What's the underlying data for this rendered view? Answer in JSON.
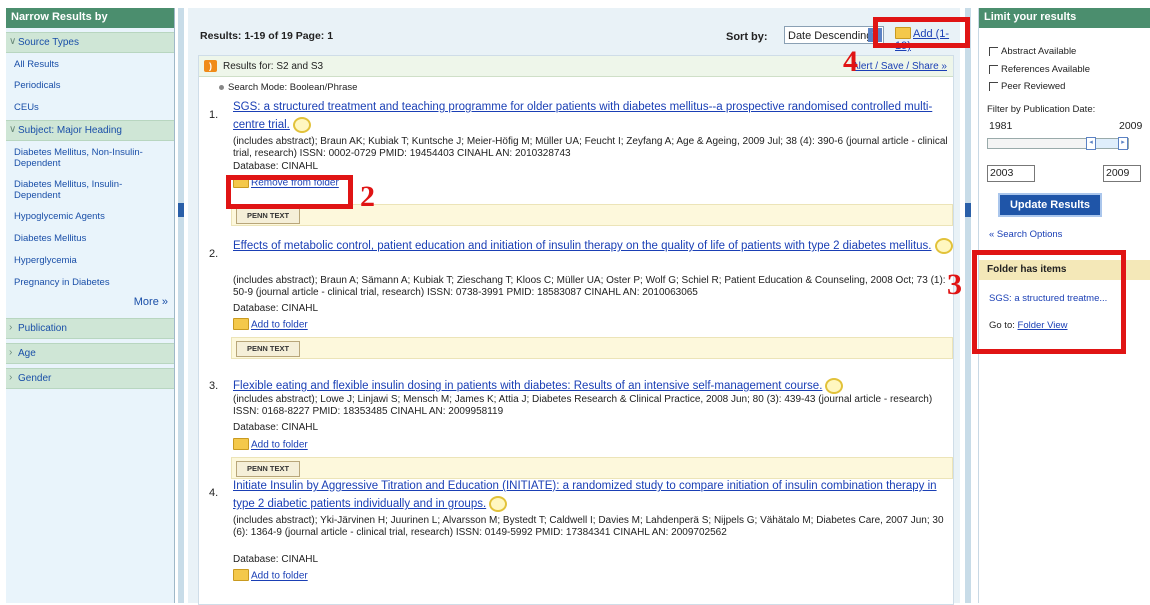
{
  "left_sidebar": {
    "header": "Narrow Results by",
    "source_types_label": "Source Types",
    "source_types": [
      "All Results",
      "Periodicals",
      "CEUs"
    ],
    "subject_label": "Subject: Major Heading",
    "subjects": [
      "Diabetes Mellitus, Non-Insulin-Dependent",
      "Diabetes Mellitus, Insulin-Dependent",
      "Hypoglycemic Agents",
      "Diabetes Mellitus",
      "Hyperglycemia",
      "Pregnancy in Diabetes"
    ],
    "more": "More »",
    "groups": [
      "Publication",
      "Age",
      "Gender"
    ]
  },
  "results_bar": {
    "label": "Results: 1-19 of 19   Page: 1",
    "sort_label": "Sort by:",
    "sort_value": "Date Descending",
    "add_all": "Add (1-19)"
  },
  "results_for": {
    "label": "Results for:  S2 and S3",
    "alert": "Alert / Save / Share »",
    "mode": "Search Mode: Boolean/Phrase"
  },
  "records": [
    {
      "num": "1.",
      "title": "SGS: a structured treatment and teaching programme for older patients with diabetes mellitus--a prospective randomised controlled multi-centre trial.",
      "details": "(includes abstract); Braun AK; Kubiak T; Kuntsche J; Meier-Höfig M; Müller UA; Feucht I; Zeyfang A; Age & Ageing, 2009 Jul; 38 (4): 390-6 (journal article - clinical trial, research) ISSN: 0002-0729 PMID: 19454403 CINAHL AN: 2010328743",
      "database": "Database: CINAHL",
      "folder_action": "Remove from folder"
    },
    {
      "num": "2.",
      "title": "Effects of metabolic control, patient education and initiation of insulin therapy on the quality of life of patients with type 2 diabetes mellitus.",
      "details": "(includes abstract); Braun A; Sämann A; Kubiak T; Zieschang T; Kloos C; Müller UA; Oster P; Wolf G; Schiel R; Patient Education & Counseling, 2008 Oct; 73 (1): 50-9 (journal article - clinical trial, research) ISSN: 0738-3991 PMID: 18583087 CINAHL AN: 2010063065",
      "database": "Database: CINAHL",
      "folder_action": "Add to folder"
    },
    {
      "num": "3.",
      "title": "Flexible eating and flexible insulin dosing in patients with diabetes: Results of an intensive self-management course.",
      "details": "(includes abstract); Lowe J; Linjawi S; Mensch M; James K; Attia J; Diabetes Research & Clinical Practice, 2008 Jun; 80 (3): 439-43 (journal article - research) ISSN: 0168-8227 PMID: 18353485 CINAHL AN: 2009958119",
      "database": "Database: CINAHL",
      "folder_action": "Add to folder"
    },
    {
      "num": "4.",
      "title": "Initiate Insulin by Aggressive Titration and Education (INITIATE): a randomized study to compare initiation of insulin combination therapy in type 2 diabetic patients individually and in groups.",
      "details": "(includes abstract); Yki-Järvinen H; Juurinen L; Alvarsson M; Bystedt T; Caldwell I; Davies M; Lahdenperä S; Nijpels G; Vähätalo M; Diabetes Care, 2007 Jun; 30 (6): 1364-9 (journal article - clinical trial, research) ISSN: 0149-5992 PMID: 17384341 CINAHL AN: 2009702562",
      "database": "Database: CINAHL",
      "folder_action": "Add to folder"
    }
  ],
  "fulltext_button": "PENN TEXT",
  "right_sidebar": {
    "header": "Limit your results",
    "checks": [
      "Abstract Available",
      "References Available",
      "Peer Reviewed"
    ],
    "pub_date_label": "Filter by Publication Date:",
    "range_min": "1981",
    "range_max": "2009",
    "from_value": "2003",
    "to_value": "2009",
    "update_button": "Update Results",
    "search_options": "« Search Options",
    "folder_header": "Folder has items",
    "folder_item": "SGS: a structured treatme...",
    "goto_label": "Go to:",
    "folder_view": "Folder View"
  },
  "annotations": [
    "2",
    "3",
    "4"
  ],
  "colors": {
    "header_green": "#4b8e6e",
    "link_blue": "#1a3fb5",
    "annotation_red": "#e01414"
  }
}
